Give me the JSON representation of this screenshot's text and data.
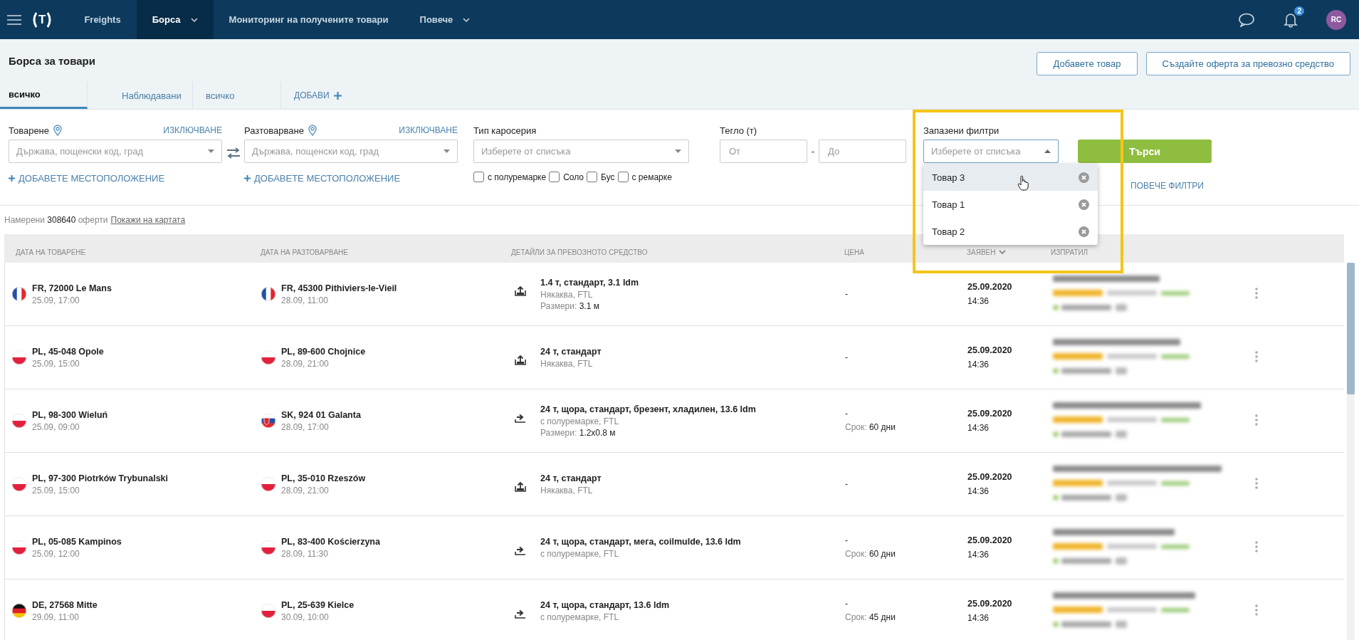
{
  "nav": {
    "logo": "T",
    "items": [
      {
        "label": "Freights",
        "selected": false,
        "dropdown": false
      },
      {
        "label": "Борса",
        "selected": true,
        "dropdown": true
      },
      {
        "label": "Мониторинг на получените товари",
        "selected": false,
        "dropdown": false
      },
      {
        "label": "Повече",
        "selected": false,
        "dropdown": true
      }
    ],
    "notifications": "2",
    "avatar": "RC"
  },
  "page": {
    "title": "Борса за товари",
    "buttons": [
      "Добавете товар",
      "Създайте оферта за превозно средство"
    ]
  },
  "tabs": [
    {
      "label": "всичко",
      "selected": true
    },
    {
      "label": "Наблюдавани",
      "selected": false
    },
    {
      "label": "всичко",
      "selected": false
    }
  ],
  "add_tab": "ДОБАВИ",
  "filters": {
    "places": [
      {
        "label": "Товарене",
        "exclude": "ИЗКЛЮЧВАНЕ",
        "placeholder": "Държава, пощенски код, град",
        "add": "ДОБАВЕТЕ МЕСТОПОЛОЖЕНИЕ"
      },
      {
        "label": "Разтоварване",
        "exclude": "ИЗКЛЮЧВАНЕ",
        "placeholder": "Държава, пощенски код, град",
        "add": "ДОБАВЕТЕ МЕСТОПОЛОЖЕНИЕ"
      }
    ],
    "body_type": {
      "label": "Тип каросерия",
      "placeholder": "Изберете от списъка",
      "options": [
        {
          "label": "с полуремарке",
          "checked": false
        },
        {
          "label": "Соло",
          "checked": false
        },
        {
          "label": "Бус",
          "checked": false
        },
        {
          "label": "с ремарке",
          "checked": false
        }
      ]
    },
    "weight": {
      "label": "Тегло (т)",
      "from_placeholder": "От",
      "separator": "-",
      "to_placeholder": "До"
    },
    "saved": {
      "label": "Запазени филтри",
      "placeholder": "Изберете от списъка",
      "expanded": true,
      "options": [
        {
          "label": "Товар 3",
          "selected": true
        },
        {
          "label": "Товар 1",
          "selected": false
        },
        {
          "label": "Товар 2",
          "selected": false
        }
      ]
    },
    "search_button": "Търси",
    "more_filters": "ПОВЕЧЕ ФИЛТРИ"
  },
  "results": {
    "prefix": "Намерени",
    "count": "308640",
    "suffix": "оферти",
    "map_link": "Покажи на картата"
  },
  "table": {
    "columns": [
      "ДАТА НА ТОВАРЕНЕ",
      "ДАТА НА РАЗТОВАРВАНЕ",
      "ДЕТАЙЛИ ЗА ПРЕВОЗНОТО СРЕДСТВО",
      "ЦЕНА",
      "ЗАЯВЕН",
      "ИЗПРАТИЛ"
    ],
    "rows": [
      {
        "from": {
          "kind": "fr",
          "place": "FR, 72000 Le Mans",
          "time": "25.09, 17:00"
        },
        "to": {
          "kind": "fr",
          "place": "FR, 45300 Pithiviers-le-Vieil",
          "time": "28.09, 11:00"
        },
        "vehicle": {
          "kind": "top",
          "title": "1.4 т, стандарт, 3.1 ldm",
          "subtitle": "Някаква, FTL",
          "size_label": "Размери:",
          "size": "3.1 м"
        },
        "price": "-",
        "date": "25.09.2020",
        "time": "14:36"
      },
      {
        "from": {
          "kind": "pl",
          "place": "PL, 45-048 Opole",
          "time": "25.09, 15:00"
        },
        "to": {
          "kind": "pl",
          "place": "PL, 89-600 Chojnice",
          "time": "28.09, 21:00"
        },
        "vehicle": {
          "kind": "top",
          "title": "24 т, стандарт",
          "subtitle": "Някаква, FTL"
        },
        "price": "-",
        "date": "25.09.2020",
        "time": "14:36"
      },
      {
        "from": {
          "kind": "pl",
          "place": "PL, 98-300 Wieluń",
          "time": "25.09, 09:00"
        },
        "to": {
          "kind": "sk",
          "place": "SK, 924 01 Galanta",
          "time": "28.09, 17:00"
        },
        "vehicle": {
          "kind": "side",
          "title": "24 т, щора, стандарт, брезент, хладилен, 13.6 ldm",
          "subtitle": "с полуремарке, FTL",
          "size_label": "Размери:",
          "size": "1.2x0.8 м"
        },
        "price": "-",
        "term_label": "Срок:",
        "term": "60 дни",
        "date": "25.09.2020",
        "time": "14:36"
      },
      {
        "from": {
          "kind": "pl",
          "place": "PL, 97-300 Piotrków Trybunalski",
          "time": "25.09, 15:00"
        },
        "to": {
          "kind": "pl",
          "place": "PL, 35-010 Rzeszów",
          "time": "28.09, 21:00"
        },
        "vehicle": {
          "kind": "top",
          "title": "24 т, стандарт",
          "subtitle": "Някаква, FTL"
        },
        "price": "-",
        "date": "25.09.2020",
        "time": "14:36"
      },
      {
        "from": {
          "kind": "pl",
          "place": "PL, 05-085 Kampinos",
          "time": "25.09, 12:00"
        },
        "to": {
          "kind": "pl",
          "place": "PL, 83-400 Kościerzyna",
          "time": "28.09, 11:30"
        },
        "vehicle": {
          "kind": "side",
          "title": "24 т, щора, стандарт, мега, coilmulde, 13.6 ldm",
          "subtitle": "с полуремарке, FTL"
        },
        "price": "-",
        "term_label": "Срок:",
        "term": "60 дни",
        "date": "25.09.2020",
        "time": "14:36"
      },
      {
        "from": {
          "kind": "de",
          "place": "DE, 27568 Mitte",
          "time": "29.09, 11:00"
        },
        "to": {
          "kind": "pl",
          "place": "PL, 25-639 Kielce",
          "time": "30.09, 10:00"
        },
        "vehicle": {
          "kind": "side",
          "title": "24 т, щора, стандарт, 13.6 ldm",
          "subtitle": "с полуремарке, FTL"
        },
        "price": "-",
        "term_label": "Срок:",
        "term": "45 дни",
        "date": "25.09.2020",
        "time": "14:36"
      }
    ]
  }
}
